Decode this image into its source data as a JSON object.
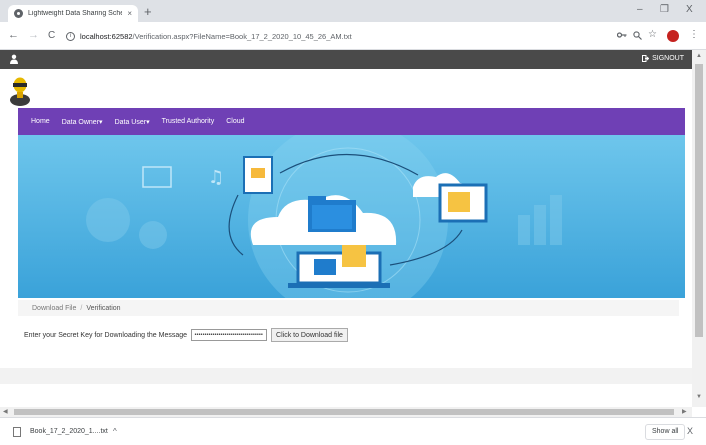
{
  "browser": {
    "tab_title": "Lightweight Data Sharing Schem",
    "tab_close": "×",
    "new_tab": "+",
    "minimize": "–",
    "restore": "❐",
    "close": "X",
    "back": "←",
    "forward": "→",
    "reload": "C",
    "url_host": "localhost:62582",
    "url_path": "/Verification.aspx?FileName=Book_17_2_2020_10_45_26_AM.txt",
    "menu": "⋮"
  },
  "page": {
    "signout_label": "SIGNOUT",
    "menu": [
      "Home",
      "Data Owner▾",
      "Data User▾",
      "Trusted Authority",
      "Cloud"
    ],
    "breadcrumb": {
      "first": "Download File",
      "separator": "/",
      "current": "Verification"
    },
    "form": {
      "label": "Enter your Secret Key for Downloading the Message",
      "secret_value": "••••••••••••••••••••••••••••••••••",
      "button_label": "Click to Download file"
    },
    "colors": {
      "menu_bg": "#6f40b5",
      "topbar_bg": "#4a4a4a"
    }
  },
  "download_shelf": {
    "file_name": "Book_17_2_2020_1....txt",
    "caret": "^",
    "show_all": "Show all",
    "close": "X"
  }
}
